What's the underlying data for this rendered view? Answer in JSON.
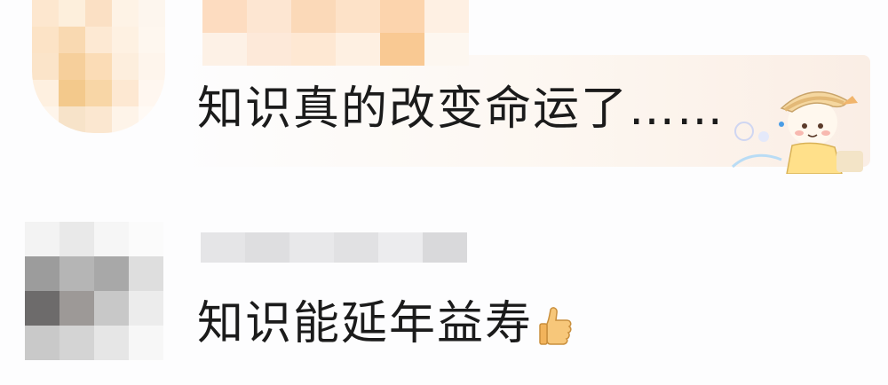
{
  "comments": [
    {
      "text": "知识真的改变命运了……",
      "avatar_colors": [
        "#fde7cf",
        "#fdefdc",
        "#fbe0c4",
        "#fef3e6",
        "#fdf6ee",
        "#fce3c6",
        "#f9d9b1",
        "#fde9d3",
        "#fef1e2",
        "#fef7ef",
        "#fbe4c9",
        "#f6cf9b",
        "#fbdcb6",
        "#fdeedd",
        "#fef5ec",
        "#fef0e0",
        "#f3c98c",
        "#f8d6a6",
        "#fde8d2",
        "#fff7f0",
        "#fef5eb",
        "#f7e3c9",
        "#fbe7d0",
        "#fef4e9",
        "#fffaf5"
      ],
      "name_colors": [
        "#fddcc0",
        "#fde6d2",
        "#fbd9b8",
        "#fde2c8",
        "#fcd4ad",
        "#fef0e3",
        "#fdf1e6",
        "#fde9d9",
        "#fee8d3",
        "#fef0e2",
        "#f9c993",
        "#fdf7f0"
      ]
    },
    {
      "text": "知识能延年益寿",
      "emoji": "thumbs-up-icon",
      "avatar_colors": [
        "#f3f3f3",
        "#e9e9e9",
        "#f6f6f6",
        "#fbfbfb",
        "#9c9c9c",
        "#b5b5b5",
        "#a8a8a8",
        "#dedede",
        "#6d6b6b",
        "#9d9997",
        "#c8c8c8",
        "#ececec",
        "#c9c9c9",
        "#d4d4d4",
        "#e6e6e6",
        "#f7f7f7"
      ],
      "name_colors": [
        "#e5e5e7",
        "#dedee0",
        "#e8e8ea",
        "#e1e1e3",
        "#ececee",
        "#d9d9db"
      ]
    }
  ],
  "sticker": "cartoon-hat-girl-sticker"
}
